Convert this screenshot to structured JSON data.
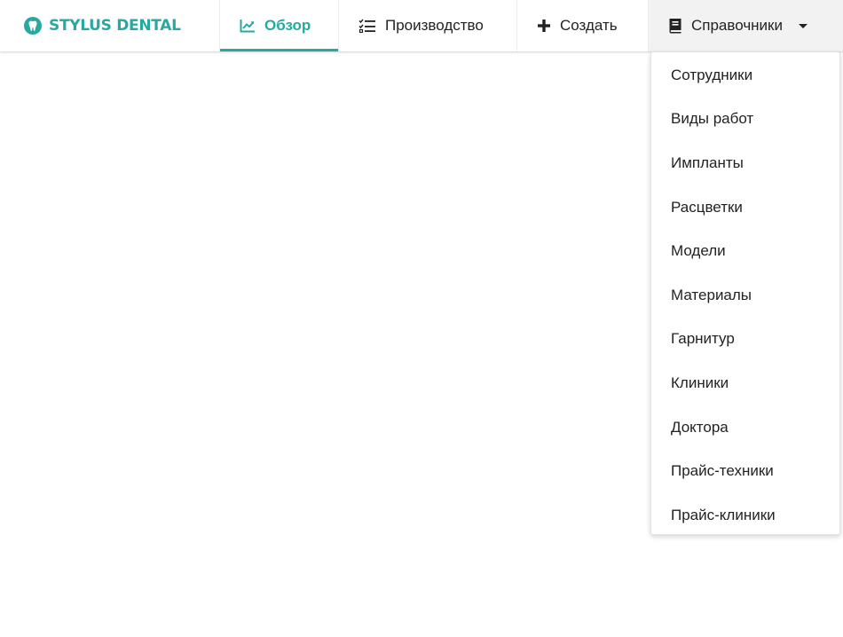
{
  "brand": {
    "name": "STYLUS DENTAL",
    "color": "#27a9a1"
  },
  "nav": {
    "overview": {
      "label": "Обзор",
      "icon": "chart-line-icon",
      "active": true
    },
    "production": {
      "label": "Производство",
      "icon": "list-check-icon"
    },
    "create": {
      "label": "Создать",
      "icon": "plus-icon"
    },
    "references": {
      "label": "Справочники",
      "icon": "book-icon",
      "open": true
    }
  },
  "dropdown": {
    "items": [
      "Сотрудники",
      "Виды работ",
      "Импланты",
      "Расцветки",
      "Модели",
      "Материалы",
      "Гарнитур",
      "Клиники",
      "Доктора",
      "Прайс-техники",
      "Прайс-клиники"
    ]
  },
  "colors": {
    "accent": "#27a9a1",
    "open_tab_bg": "#f2f2f2"
  }
}
